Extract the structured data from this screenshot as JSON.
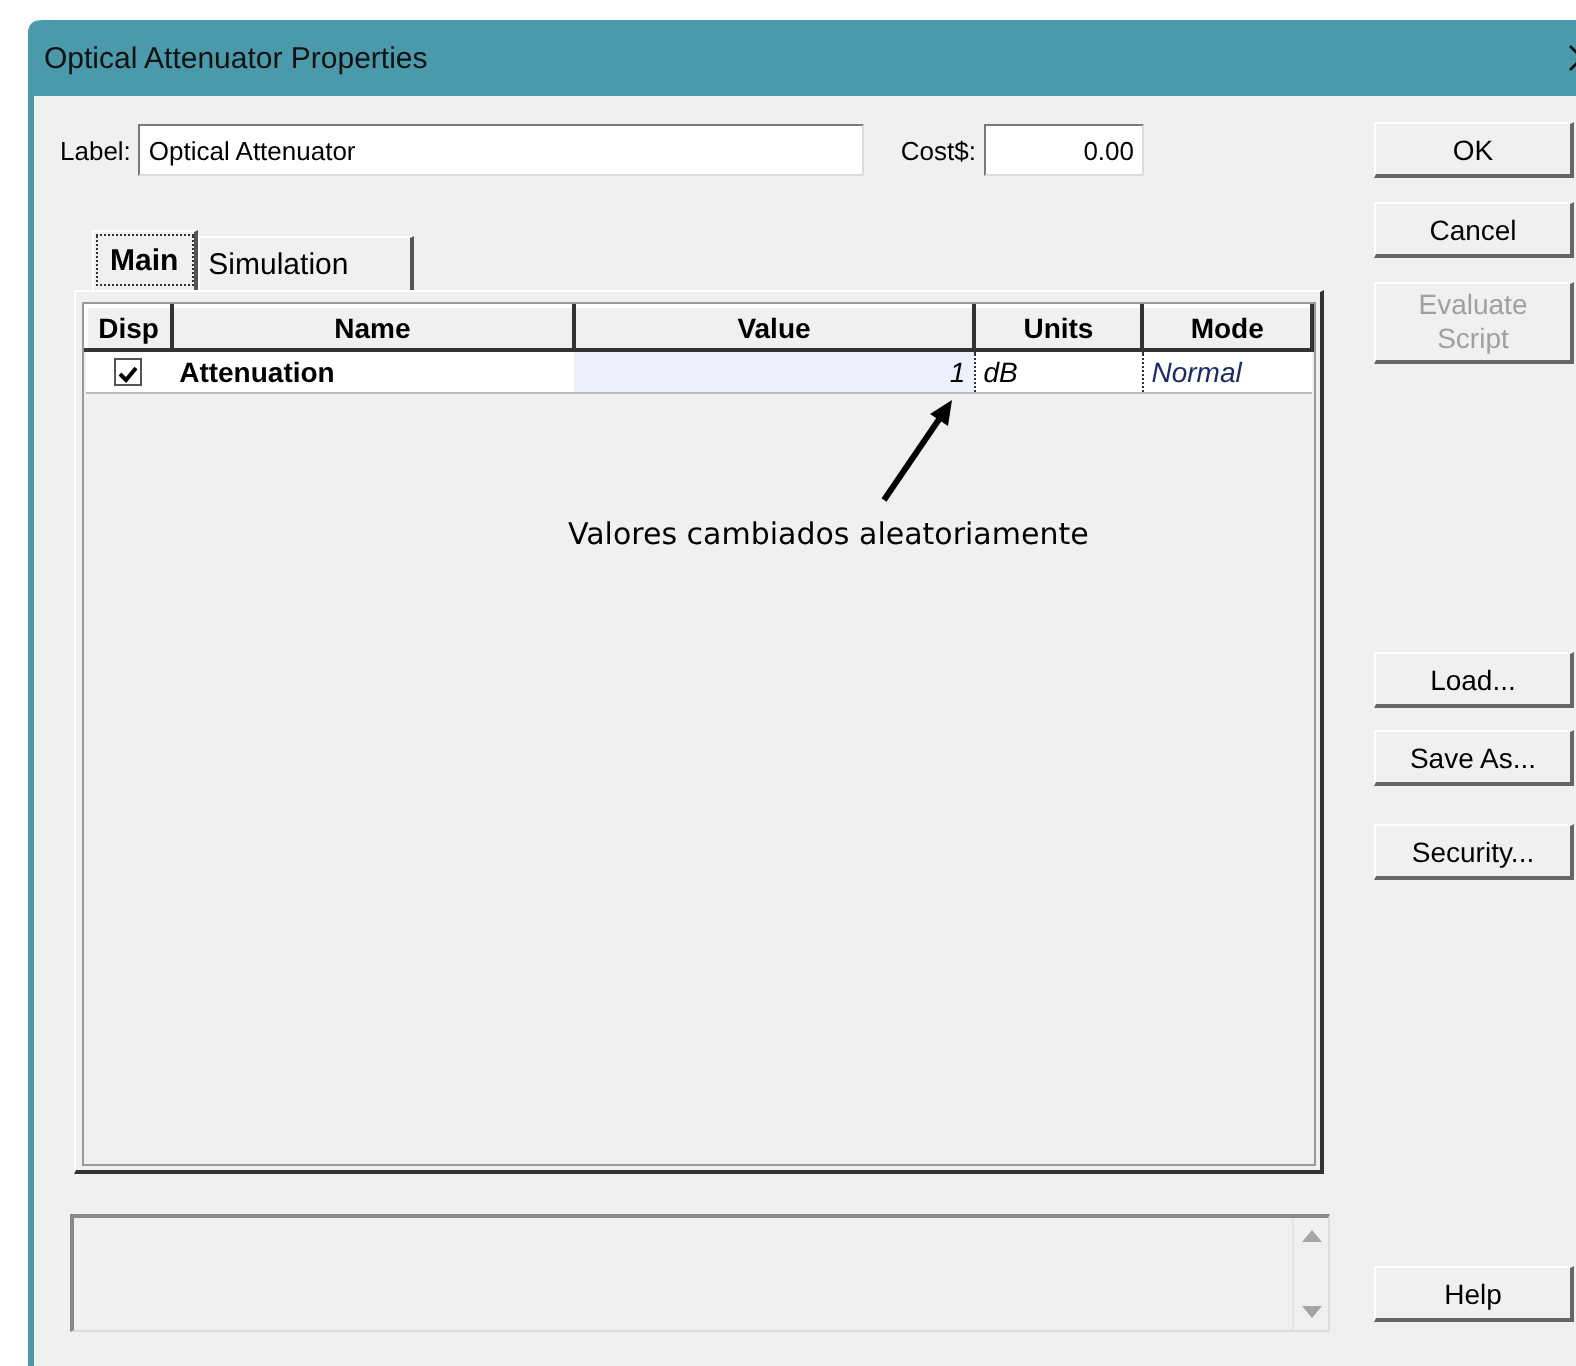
{
  "window": {
    "title": "Optical Attenuator Properties"
  },
  "label_field": {
    "label": "Label:",
    "value": "Optical Attenuator"
  },
  "cost_field": {
    "label": "Cost$:",
    "value": "0.00"
  },
  "tabs": [
    {
      "label": "Main",
      "selected": true
    },
    {
      "label": "Simulation",
      "selected": false
    }
  ],
  "table": {
    "columns": [
      "Disp",
      "Name",
      "Value",
      "Units",
      "Mode"
    ],
    "rows": [
      {
        "checked": true,
        "name": "Attenuation",
        "value": "1",
        "units": "dB",
        "mode": "Normal"
      }
    ]
  },
  "annotation": "Valores cambiados aleatoriamente",
  "action_buttons": [
    {
      "label": "OK",
      "disabled": false
    },
    {
      "label": "Cancel",
      "disabled": false
    },
    {
      "label": "Evaluate Script",
      "disabled": true
    }
  ],
  "file_buttons": [
    {
      "label": "Load...",
      "disabled": false
    },
    {
      "label": "Save As...",
      "disabled": false
    },
    {
      "label": "Security...",
      "disabled": false
    }
  ],
  "help_button": {
    "label": "Help",
    "disabled": false
  }
}
